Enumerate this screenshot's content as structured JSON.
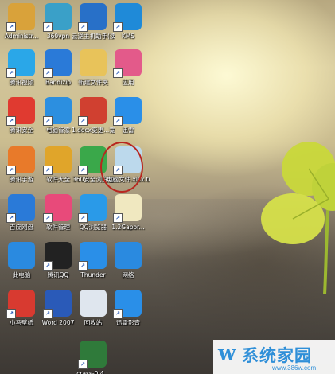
{
  "desktop": {
    "icons": [
      {
        "label": "Administr...",
        "icon": "admin-folder-icon",
        "color": "#d9a23a"
      },
      {
        "label": "360vpn",
        "icon": "vpn-icon",
        "color": "#3aa0c8"
      },
      {
        "label": "云逆主机助手(演示版)",
        "icon": "host-assistant-icon",
        "color": "#2870c8"
      },
      {
        "label": "KMS",
        "icon": "kms-icon",
        "color": "#1f8ad8"
      },
      {
        "label": "腾讯视频",
        "icon": "tencent-video-icon",
        "color": "#2aa7e8"
      },
      {
        "label": "Bandizip",
        "icon": "bandizip-icon",
        "color": "#2a7ad8"
      },
      {
        "label": "新建文件夹",
        "icon": "folder-icon",
        "color": "#e8c35a"
      },
      {
        "label": "应用",
        "icon": "app-colorful-icon",
        "color": "#e35a8a"
      },
      {
        "label": "腾讯安全",
        "icon": "tencent-security-icon",
        "color": "#e03a30"
      },
      {
        "label": "电脑管家",
        "icon": "pc-manager-icon",
        "color": "#2c8fe0"
      },
      {
        "label": "1.docx变更...宽...",
        "icon": "word-document-icon",
        "color": "#d04030"
      },
      {
        "label": "迅雷",
        "icon": "thunder-icon",
        "color": "#2a8fe8"
      },
      {
        "label": "腾讯手游",
        "icon": "tencent-games-icon",
        "color": "#e87a2a"
      },
      {
        "label": "软件大全",
        "icon": "software-store-icon",
        "color": "#e0a52a"
      },
      {
        "label": "360安全浏览器",
        "icon": "browser-icon",
        "color": "#3aa84a"
      },
      {
        "label": "电脑文件.xlsx.tmp",
        "icon": "temp-file-icon",
        "color": "#bcd9ec"
      },
      {
        "label": "百度网盘",
        "icon": "baidu-netdisk-icon",
        "color": "#2a7ad8"
      },
      {
        "label": "软件管理",
        "icon": "app-manager-icon",
        "color": "#e84a7a"
      },
      {
        "label": "QQ浏览器",
        "icon": "qq-browser-icon",
        "color": "#2a9ae8"
      },
      {
        "label": "1.2Gapor...",
        "icon": "text-file-icon",
        "color": "#f0e8c0"
      },
      {
        "label": "此电脑",
        "icon": "this-pc-icon",
        "color": "#2a8ae0"
      },
      {
        "label": "腾讯QQ",
        "icon": "qq-icon",
        "color": "#222222"
      },
      {
        "label": "Thunder",
        "icon": "thunder-bird-icon",
        "color": "#2a8fe8"
      },
      {
        "label": "网络",
        "icon": "network-icon",
        "color": "#2a8ae0"
      },
      {
        "label": "小马壁纸",
        "icon": "wallpaper-icon",
        "color": "#d83a30"
      },
      {
        "label": "Word 2007",
        "icon": "word-icon",
        "color": "#2a5ab8"
      },
      {
        "label": "回收站",
        "icon": "recycle-bin-icon",
        "color": "#dfe6ee"
      },
      {
        "label": "迅雷影音",
        "icon": "thunder-video-icon",
        "color": "#2a8fe8"
      },
      {
        "label": "crass-0.4...",
        "icon": "crass-icon",
        "color": "#2f7a3a"
      }
    ]
  },
  "watermark": {
    "logo": "w",
    "text": "系统家园",
    "url": "www.386w.com"
  },
  "colors": {
    "highlight_circle": "#b8261f",
    "watermark_blue": "#2f8fd8"
  }
}
